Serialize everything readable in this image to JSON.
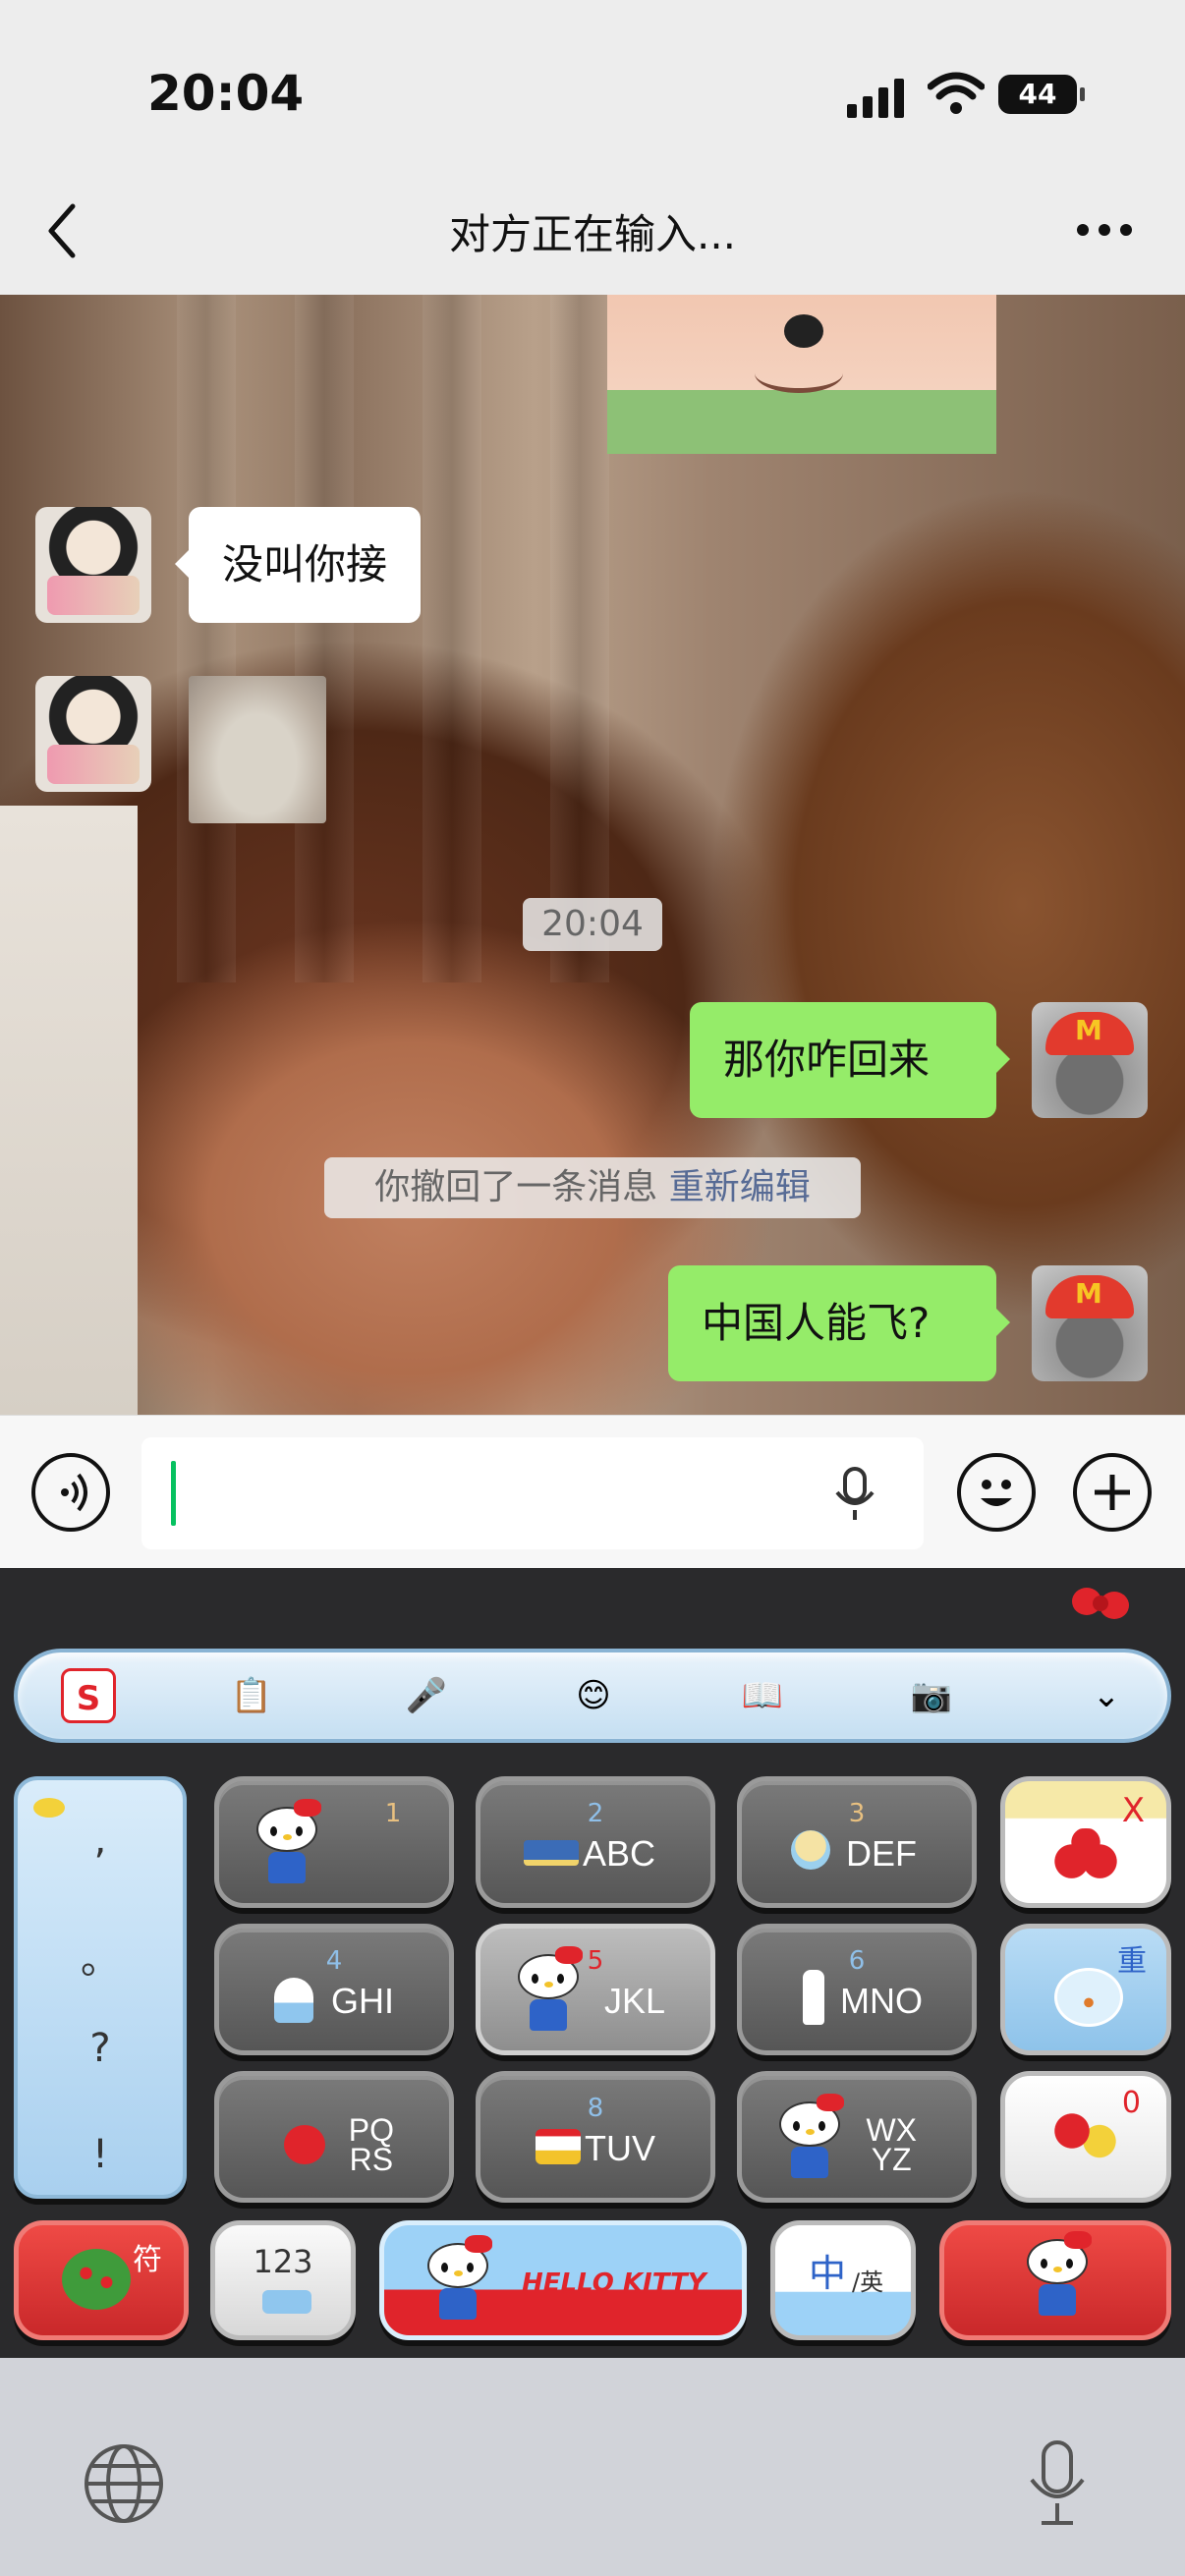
{
  "status_bar": {
    "time": "20:04",
    "battery": "44"
  },
  "nav": {
    "title": "对方正在输入..."
  },
  "messages": {
    "left_text": "没叫你接",
    "timestamp": "20:04",
    "right_1": "那你咋回来",
    "recall_text": "你撤回了一条消息",
    "recall_link": "重新编辑",
    "right_2": "中国人能飞?"
  },
  "input": {
    "value": ""
  },
  "keyboard": {
    "punct": [
      ",",
      "。",
      "?",
      "!"
    ],
    "keys": [
      {
        "num": "1",
        "letters": ""
      },
      {
        "num": "2",
        "letters": "ABC"
      },
      {
        "num": "3",
        "letters": "DEF"
      },
      {
        "num": "4",
        "letters": "GHI"
      },
      {
        "num": "5",
        "letters": "JKL"
      },
      {
        "num": "6",
        "letters": "MNO"
      },
      {
        "num": "",
        "letters": "PQ\nRS"
      },
      {
        "num": "8",
        "letters": "TUV"
      },
      {
        "num": "",
        "letters": "WX\nYZ"
      }
    ],
    "delete_label": "X",
    "reenter_label": "重",
    "zero_label": "0",
    "symbol_label": "符",
    "num_label": "123",
    "space_label": "HELLO KITTY",
    "lang_cn": "中",
    "lang_en": "/英"
  },
  "colors": {
    "bubble_green": "#95ec69",
    "link_blue": "#576b95",
    "accent_red": "#e0242b"
  }
}
